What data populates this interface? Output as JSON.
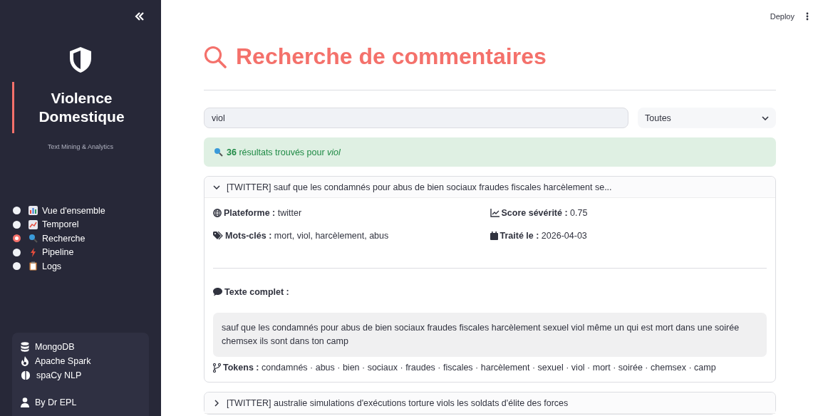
{
  "sidebar": {
    "title": "Violence Domestique",
    "subtitle": "Text Mining & Analytics",
    "nav": [
      {
        "label": "Vue d'ensemble",
        "selected": false
      },
      {
        "label": "Temporel",
        "selected": false
      },
      {
        "label": "Recherche",
        "selected": true
      },
      {
        "label": "Pipeline",
        "selected": false
      },
      {
        "label": "Logs",
        "selected": false
      }
    ],
    "tech": [
      "MongoDB",
      "Apache Spark",
      "spaCy NLP"
    ],
    "author": "By Dr EPL"
  },
  "header": {
    "deploy": "Deploy"
  },
  "page": {
    "title": "Recherche de commentaires",
    "search": {
      "value": "viol"
    },
    "filter": {
      "value": "Toutes"
    },
    "alert": "**36** résultats trouvés pour *viol*",
    "results": [
      {
        "expanded": true,
        "title": "[TWITTER] sauf que les condamnés pour abus de bien sociaux fraudes fiscales harcèlement se...",
        "fields": [
          {
            "label": "Plateforme :",
            "value": "twitter"
          },
          {
            "label": "Score sévérité :",
            "value": "0.75"
          },
          {
            "label": "Mots-clés :",
            "value": "mort, viol, harcèlement, abus"
          },
          {
            "label": "Traité le :",
            "value": "2026-04-03"
          }
        ],
        "full_label": "Texte complet :",
        "full_text": "sauf que les condamnés pour abus de bien sociaux fraudes fiscales harcèlement sexuel viol même un qui est mort dans une soirée chemsex ils sont dans ton camp",
        "tokens_label": "Tokens :",
        "tokens": "condamnés · abus · bien · sociaux · fraudes · fiscales · harcèlement · sexuel · viol · mort · soirée · chemsex · camp"
      },
      {
        "expanded": false,
        "title": "[TWITTER] australie simulations d'exécutions torture viols les soldats d'élite des forces"
      }
    ]
  }
}
